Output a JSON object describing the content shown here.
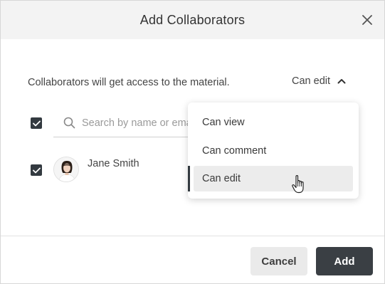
{
  "dialog": {
    "title": "Add Collaborators",
    "info_text": "Collaborators will get access to the material.",
    "permission_label": "Can edit"
  },
  "search": {
    "placeholder": "Search by name or email"
  },
  "collaborators": [
    {
      "name": "Jane Smith",
      "checked": true
    }
  ],
  "select_all_checked": true,
  "dropdown": {
    "options": [
      "Can view",
      "Can comment",
      "Can edit"
    ],
    "selected": "Can edit"
  },
  "footer": {
    "cancel_label": "Cancel",
    "add_label": "Add"
  },
  "icons": {
    "close": "close-icon",
    "search": "search-icon",
    "chevron": "chevron-up-icon",
    "check": "checkmark-icon",
    "pointer": "hand-pointer-icon"
  },
  "colors": {
    "accent_dark": "#3a3f44",
    "header_bg": "#f3f3f3",
    "selected_item_bg": "#ececec"
  }
}
